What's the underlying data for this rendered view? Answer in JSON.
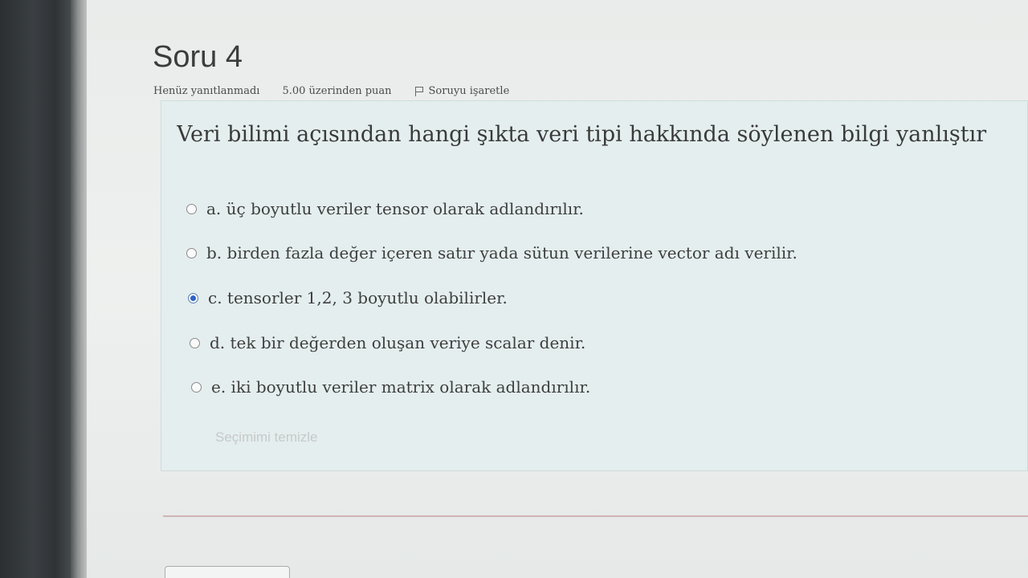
{
  "question": {
    "title": "Soru 4",
    "status": "Henüz yanıtlanmadı",
    "grade": "5.00 üzerinden puan",
    "flag_label": "Soruyu işaretle",
    "text": "Veri bilimi açısından hangi şıkta veri tipi hakkında söylenen bilgi yanlıştır",
    "answers": [
      {
        "label": "a. üç boyutlu veriler tensor olarak adlandırılır.",
        "selected": false
      },
      {
        "label": "b. birden fazla değer içeren satır yada sütun verilerine vector adı verilir.",
        "selected": false
      },
      {
        "label": "c. tensorler 1,2, 3 boyutlu olabilirler.",
        "selected": true
      },
      {
        "label": "d. tek bir değerden oluşan veriye scalar denir.",
        "selected": false
      },
      {
        "label": "e. iki boyutlu veriler matrix olarak adlandırılır.",
        "selected": false
      }
    ],
    "clear_label": "Seçimimi temizle"
  },
  "icons": {
    "flag": "flag-icon",
    "radio": "radio-button-icon"
  }
}
